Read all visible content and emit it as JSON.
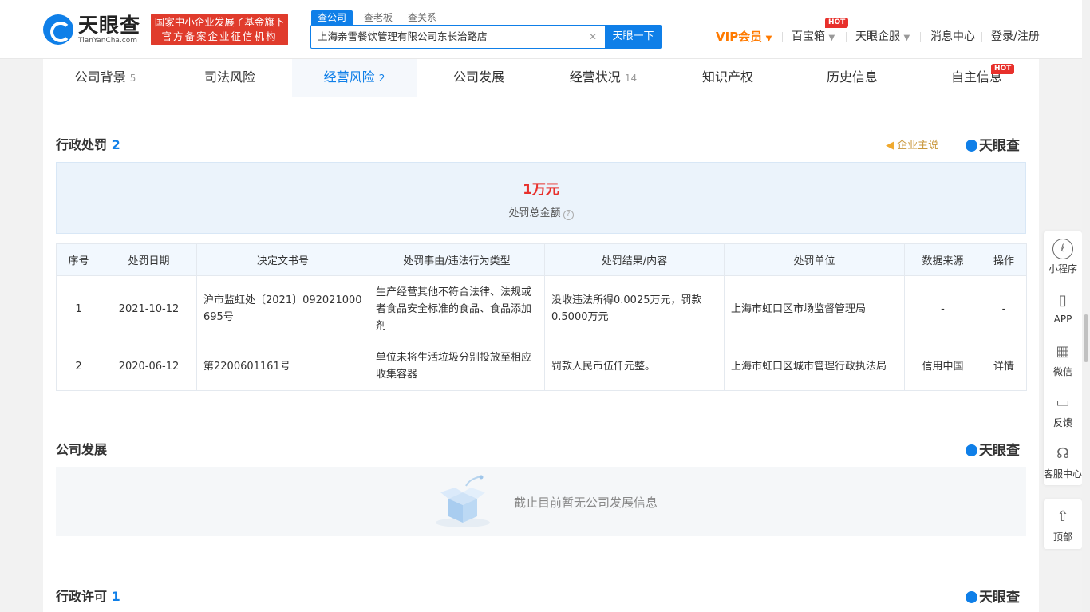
{
  "header": {
    "logo_text": "天眼查",
    "logo_sub": "TianYanCha.com",
    "gov_badge_line1": "国家中小企业发展子基金旗下",
    "gov_badge_line2": "官方备案企业征信机构",
    "search_tabs": [
      "查公司",
      "查老板",
      "查关系"
    ],
    "search_value": "上海亲雪餐饮管理有限公司东长治路店",
    "search_button": "天眼一下",
    "vip_label": "VIP会员",
    "treasure_label": "百宝箱",
    "enterprise_label": "天眼企服",
    "message_label": "消息中心",
    "login_label": "登录/注册",
    "hot_badge": "HOT"
  },
  "tabs": [
    {
      "label": "公司背景",
      "count": "5"
    },
    {
      "label": "司法风险",
      "count": ""
    },
    {
      "label": "经营风险",
      "count": "2"
    },
    {
      "label": "公司发展",
      "count": ""
    },
    {
      "label": "经营状况",
      "count": "14"
    },
    {
      "label": "知识产权",
      "count": ""
    },
    {
      "label": "历史信息",
      "count": ""
    },
    {
      "label": "自主信息",
      "count": ""
    }
  ],
  "penalty": {
    "title": "行政处罚",
    "count": "2",
    "claim": "企业主说",
    "brand": "天眼查",
    "total_amount": "1万元",
    "total_label": "处罚总金额",
    "help": "?",
    "columns": [
      "序号",
      "处罚日期",
      "决定文书号",
      "处罚事由/违法行为类型",
      "处罚结果/内容",
      "处罚单位",
      "数据来源",
      "操作"
    ],
    "rows": [
      [
        "1",
        "2021-10-12",
        "沪市监虹处〔2021〕092021000695号",
        "生产经营其他不符合法律、法规或者食品安全标准的食品、食品添加剂",
        "没收违法所得0.0025万元，罚款0.5000万元",
        "上海市虹口区市场监督管理局",
        "-",
        "-"
      ],
      [
        "2",
        "2020-06-12",
        "第2200601161号",
        "单位未将生活垃圾分别投放至相应收集容器",
        "罚款人民币伍仟元整。",
        "上海市虹口区城市管理行政执法局",
        "信用中国",
        "详情"
      ]
    ]
  },
  "development": {
    "title": "公司发展",
    "brand": "天眼查",
    "empty_text": "截止目前暂无公司发展信息"
  },
  "license": {
    "title": "行政许可",
    "count": "1",
    "brand": "天眼查"
  },
  "float_bar": {
    "items": [
      "小程序",
      "APP",
      "微信",
      "反馈",
      "客服中心"
    ],
    "top_label": "顶部"
  },
  "colors": {
    "brand_blue": "#0f7fe8",
    "accent_red": "#e8302b",
    "vip_orange": "#ff7a00"
  }
}
